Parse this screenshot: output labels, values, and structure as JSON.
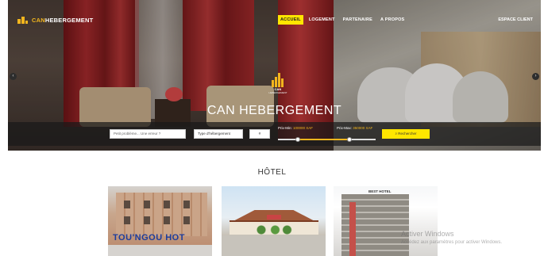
{
  "brand": {
    "prefix_icon": "building-bars-icon",
    "text_highlight": "CAN",
    "text_rest": "HEBERGEMENT"
  },
  "nav": {
    "items": [
      {
        "label": "ACCUEIL",
        "active": true
      },
      {
        "label": "LOGEMENT",
        "active": false
      },
      {
        "label": "PARTENAIRE",
        "active": false
      },
      {
        "label": "A PROPOS",
        "active": false
      }
    ],
    "client_label": "ESPACE CLIENT"
  },
  "hero": {
    "logo_text": "CAN",
    "logo_subtext": "HEBERGEMENT",
    "title": "CAN HEBERGEMENT",
    "arrow_left": "‹",
    "arrow_right": "›"
  },
  "search": {
    "problem_placeholder": "Petit problème... Une erreur ?",
    "type_value": "Type d'hébergement",
    "count_value": "#",
    "price_min_label": "Prix-Min:",
    "price_min_value": "100000 XAF",
    "price_max_label": "Prix-Max:",
    "price_max_value": "350000 XAF",
    "button_label": "⌕ Rechercher"
  },
  "section": {
    "title": "HÔTEL",
    "cards": [
      {
        "sign": "TOU'NGOU HOT"
      },
      {
        "sign": ""
      },
      {
        "sign": "BEST HOTEL"
      }
    ]
  },
  "watermark": {
    "line1": "Activer Windows",
    "line2": "Accédez aux paramètres pour activer Windows."
  },
  "colors": {
    "accent": "#ffe600",
    "brand_gold": "#f2b51e"
  }
}
